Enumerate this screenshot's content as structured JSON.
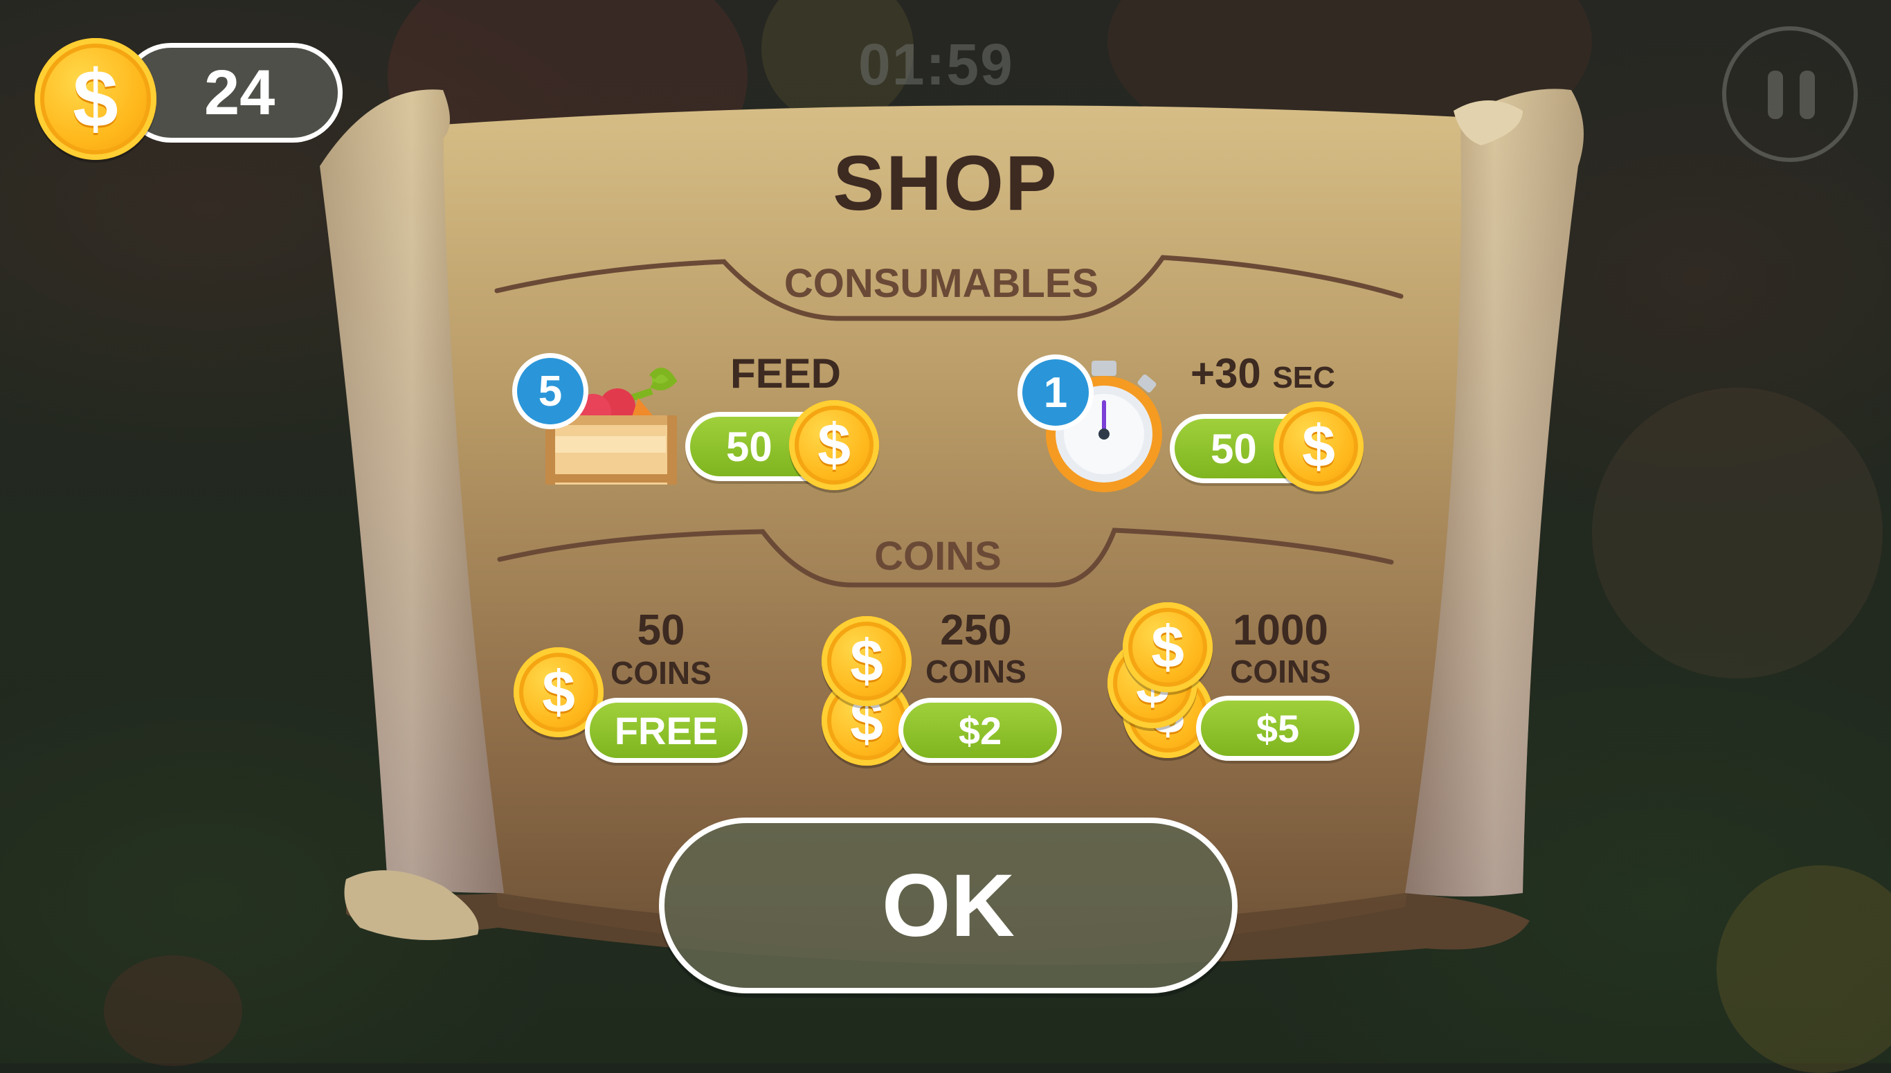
{
  "hud": {
    "coins": "24",
    "timer": "01:59"
  },
  "shop": {
    "title": "SHOP",
    "consumables_label": "CONSUMABLES",
    "coins_label": "COINS",
    "consumables": [
      {
        "name": "FEED",
        "badge": "5",
        "price": "50",
        "icon": "vegetable-crate-icon"
      },
      {
        "name": "+30",
        "name_suffix": "SEC",
        "badge": "1",
        "price": "50",
        "icon": "stopwatch-icon"
      }
    ],
    "coin_packs": [
      {
        "amount": "50",
        "unit": "COINS",
        "price": "FREE"
      },
      {
        "amount": "250",
        "unit": "COINS",
        "price": "$2"
      },
      {
        "amount": "1000",
        "unit": "COINS",
        "price": "$5"
      }
    ],
    "coin_symbol": "$",
    "ok_label": "OK"
  },
  "colors": {
    "price_green": "#8cc22b",
    "badge_blue": "#2a96d9",
    "coin_gold": "#ffb81c",
    "title_brown": "#3d2a21"
  }
}
